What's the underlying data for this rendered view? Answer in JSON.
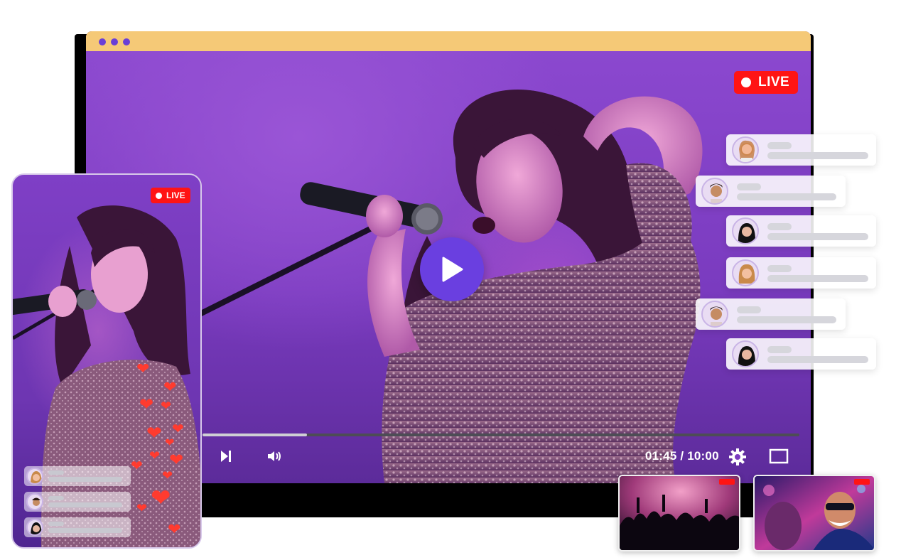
{
  "window": {
    "title_dots": [
      "dot",
      "dot",
      "dot"
    ],
    "colors": {
      "titlebar": "#f5c977",
      "dots": "#6a3fd6",
      "accent": "#6a3fe0",
      "live": "#ff1414"
    }
  },
  "player": {
    "live_label": "LIVE",
    "time_display": "01:45 / 10:00",
    "progress_fraction": 0.175,
    "controls": {
      "play": "play-icon",
      "next": "skip-next-icon",
      "volume": "volume-icon",
      "settings": "gear-icon",
      "fullscreen": "fullscreen-icon"
    }
  },
  "phone": {
    "live_label": "LIVE",
    "hearts_icon": "heart-icon"
  }
}
